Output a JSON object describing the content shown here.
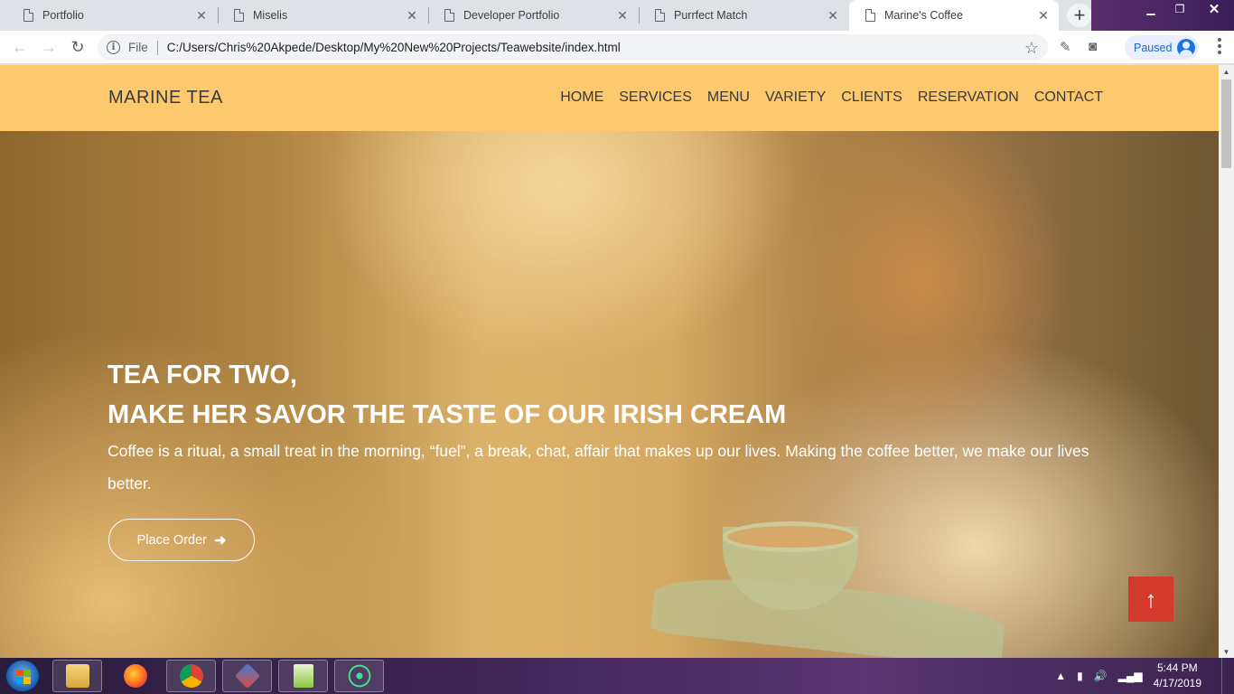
{
  "browser": {
    "tabs": [
      {
        "title": "Portfolio",
        "active": false
      },
      {
        "title": "Miselis",
        "active": false
      },
      {
        "title": "Developer Portfolio",
        "active": false
      },
      {
        "title": "Purrfect Match",
        "active": false
      },
      {
        "title": "Marine's Coffee",
        "active": true
      }
    ],
    "new_tab_icon": "+",
    "window_controls": {
      "minimize": "▁",
      "maximize": "❐",
      "close": "✕"
    },
    "address": {
      "scheme_label": "File",
      "url": "C:/Users/Chris%20Akpede/Desktop/My%20New%20Projects/Teawebsite/index.html"
    },
    "profile_status": "Paused"
  },
  "site": {
    "brand": "MARINE TEA",
    "nav": [
      "HOME",
      "SERVICES",
      "MENU",
      "VARIETY",
      "CLIENTS",
      "RESERVATION",
      "CONTACT"
    ],
    "hero": {
      "heading_line1": "TEA FOR TWO,",
      "heading_line2": "MAKE HER SAVOR THE TASTE OF OUR IRISH CREAM",
      "text": "Coffee is a ritual, a small treat in the morning, “fuel”, a break, chat, affair that makes up our lives. Making the coffee better, we make our lives better.",
      "button_label": "Place Order",
      "button_icon": "arrow-right-icon"
    },
    "scroll_top_icon": "arrow-up-icon",
    "colors": {
      "nav_bg": "#fcc96e",
      "scroll_top_bg": "#d33a2c"
    }
  },
  "taskbar": {
    "apps": [
      "windows-explorer",
      "firefox",
      "chrome",
      "git-gui",
      "notepad-plus-plus",
      "atom"
    ],
    "clock": {
      "time": "5:44 PM",
      "date": "4/17/2019"
    }
  }
}
